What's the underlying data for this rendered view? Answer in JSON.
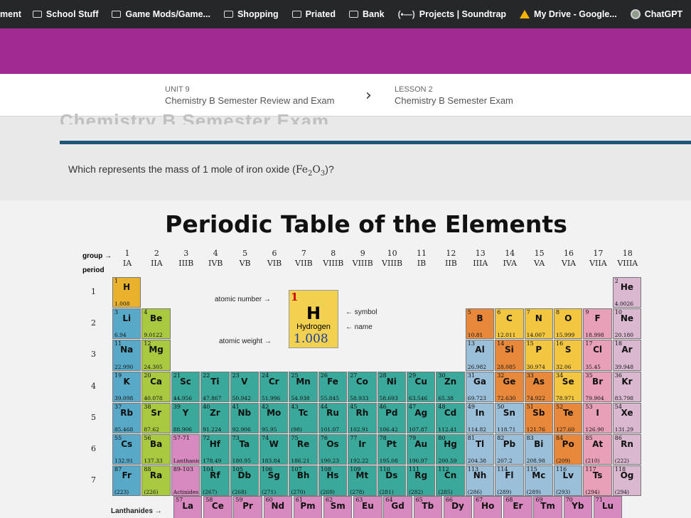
{
  "bookmarks": [
    {
      "label": "ment",
      "icon": "none"
    },
    {
      "label": "School Stuff",
      "icon": "folder-icon"
    },
    {
      "label": "Game Mods/Game...",
      "icon": "folder-icon"
    },
    {
      "label": "Shopping",
      "icon": "folder-icon"
    },
    {
      "label": "Priated",
      "icon": "folder-icon"
    },
    {
      "label": "Bank",
      "icon": "folder-icon"
    },
    {
      "label": "Projects | Soundtrap",
      "icon": "soundtrap-icon"
    },
    {
      "label": "My Drive - Google...",
      "icon": "google-drive-icon"
    },
    {
      "label": "ChatGPT",
      "icon": "chatgpt-icon"
    }
  ],
  "colors": {
    "band": "#a02a92",
    "rule": "#1d5676",
    "bookmark_bar": "#26272b"
  },
  "breadcrumb": {
    "unit_label": "UNIT 9",
    "unit_title": "Chemistry B Semester Review and Exam",
    "lesson_label": "LESSON 2",
    "lesson_title": "Chemistry B Semester Exam",
    "separator": "›"
  },
  "page_title": "Chemistry B Semester Exam",
  "question": {
    "text": "Which represents the mass of 1 mole of iron oxide (",
    "formula": "Fe",
    "sub1": "2",
    "o": "O",
    "sub2": "3",
    "end": ")?"
  },
  "table": {
    "title": "Periodic Table of the Elements",
    "group_label": "group",
    "period_label": "period",
    "groups": [
      "1",
      "2",
      "3",
      "4",
      "5",
      "6",
      "7",
      "8",
      "9",
      "10",
      "11",
      "12",
      "13",
      "14",
      "15",
      "16",
      "17",
      "18"
    ],
    "group_roman": [
      "IA",
      "IIA",
      "IIIB",
      "IVB",
      "VB",
      "VIB",
      "VIIB",
      "VIIIB",
      "VIIIB",
      "VIIIB",
      "IB",
      "IIB",
      "IIIA",
      "IVA",
      "VA",
      "VIA",
      "VIIA",
      "VIIIA"
    ],
    "periods": [
      "1",
      "2",
      "3",
      "4",
      "5",
      "6",
      "7"
    ],
    "key": {
      "atomic_number_label": "atomic number",
      "atomic_number": "1",
      "symbol_label": "symbol",
      "symbol": "H",
      "name_label": "name",
      "name": "Hydrogen",
      "atomic_weight_label": "atomic weight",
      "atomic_weight": "1.008"
    },
    "lanthanides_label": "Lanthanides",
    "elements": [
      {
        "z": "1",
        "s": "H",
        "m": "1.008",
        "c": "#e8b22e",
        "col": 1,
        "row": 1
      },
      {
        "z": "2",
        "s": "He",
        "m": "4.0026",
        "c": "#d9b8d0",
        "col": 18,
        "row": 1
      },
      {
        "z": "3",
        "s": "Li",
        "m": "6.94",
        "c": "#58a8c8",
        "col": 1,
        "row": 2
      },
      {
        "z": "4",
        "s": "Be",
        "m": "9.0122",
        "c": "#a8c940",
        "col": 2,
        "row": 2
      },
      {
        "z": "5",
        "s": "B",
        "m": "10.81",
        "c": "#e8883a",
        "col": 13,
        "row": 2
      },
      {
        "z": "6",
        "s": "C",
        "m": "12.011",
        "c": "#f2c640",
        "col": 14,
        "row": 2
      },
      {
        "z": "7",
        "s": "N",
        "m": "14.007",
        "c": "#f2c640",
        "col": 15,
        "row": 2
      },
      {
        "z": "8",
        "s": "O",
        "m": "15.999",
        "c": "#f2c640",
        "col": 16,
        "row": 2
      },
      {
        "z": "9",
        "s": "F",
        "m": "18.998",
        "c": "#e8a0b8",
        "col": 17,
        "row": 2
      },
      {
        "z": "10",
        "s": "Ne",
        "m": "20.180",
        "c": "#d9b8d0",
        "col": 18,
        "row": 2
      },
      {
        "z": "11",
        "s": "Na",
        "m": "22.990",
        "c": "#58a8c8",
        "col": 1,
        "row": 3
      },
      {
        "z": "12",
        "s": "Mg",
        "m": "24.305",
        "c": "#a8c940",
        "col": 2,
        "row": 3
      },
      {
        "z": "13",
        "s": "Al",
        "m": "26.982",
        "c": "#9bbfd8",
        "col": 13,
        "row": 3
      },
      {
        "z": "14",
        "s": "Si",
        "m": "28.085",
        "c": "#e8883a",
        "col": 14,
        "row": 3
      },
      {
        "z": "15",
        "s": "P",
        "m": "30.974",
        "c": "#f2c640",
        "col": 15,
        "row": 3
      },
      {
        "z": "16",
        "s": "S",
        "m": "32.06",
        "c": "#f2c640",
        "col": 16,
        "row": 3
      },
      {
        "z": "17",
        "s": "Cl",
        "m": "35.45",
        "c": "#e8a0b8",
        "col": 17,
        "row": 3
      },
      {
        "z": "18",
        "s": "Ar",
        "m": "39.948",
        "c": "#d9b8d0",
        "col": 18,
        "row": 3
      },
      {
        "z": "19",
        "s": "K",
        "m": "39.098",
        "c": "#58a8c8",
        "col": 1,
        "row": 4
      },
      {
        "z": "20",
        "s": "Ca",
        "m": "40.078",
        "c": "#a8c940",
        "col": 2,
        "row": 4
      },
      {
        "z": "21",
        "s": "Sc",
        "m": "44.956",
        "c": "#3aa89a",
        "col": 3,
        "row": 4
      },
      {
        "z": "22",
        "s": "Ti",
        "m": "47.867",
        "c": "#3aa89a",
        "col": 4,
        "row": 4
      },
      {
        "z": "23",
        "s": "V",
        "m": "50.942",
        "c": "#3aa89a",
        "col": 5,
        "row": 4
      },
      {
        "z": "24",
        "s": "Cr",
        "m": "51.996",
        "c": "#3aa89a",
        "col": 6,
        "row": 4
      },
      {
        "z": "25",
        "s": "Mn",
        "m": "54.938",
        "c": "#3aa89a",
        "col": 7,
        "row": 4
      },
      {
        "z": "26",
        "s": "Fe",
        "m": "55.845",
        "c": "#3aa89a",
        "col": 8,
        "row": 4
      },
      {
        "z": "27",
        "s": "Co",
        "m": "58.933",
        "c": "#3aa89a",
        "col": 9,
        "row": 4
      },
      {
        "z": "28",
        "s": "Ni",
        "m": "58.693",
        "c": "#3aa89a",
        "col": 10,
        "row": 4
      },
      {
        "z": "29",
        "s": "Cu",
        "m": "63.546",
        "c": "#3aa89a",
        "col": 11,
        "row": 4
      },
      {
        "z": "30",
        "s": "Zn",
        "m": "65.38",
        "c": "#3aa89a",
        "col": 12,
        "row": 4
      },
      {
        "z": "31",
        "s": "Ga",
        "m": "69.723",
        "c": "#9bbfd8",
        "col": 13,
        "row": 4
      },
      {
        "z": "32",
        "s": "Ge",
        "m": "72.630",
        "c": "#e8883a",
        "col": 14,
        "row": 4
      },
      {
        "z": "33",
        "s": "As",
        "m": "74.922",
        "c": "#e8883a",
        "col": 15,
        "row": 4
      },
      {
        "z": "34",
        "s": "Se",
        "m": "78.971",
        "c": "#f2c640",
        "col": 16,
        "row": 4
      },
      {
        "z": "35",
        "s": "Br",
        "m": "79.904",
        "c": "#e8a0b8",
        "col": 17,
        "row": 4
      },
      {
        "z": "36",
        "s": "Kr",
        "m": "83.798",
        "c": "#d9b8d0",
        "col": 18,
        "row": 4
      },
      {
        "z": "37",
        "s": "Rb",
        "m": "85.468",
        "c": "#58a8c8",
        "col": 1,
        "row": 5
      },
      {
        "z": "38",
        "s": "Sr",
        "m": "87.62",
        "c": "#a8c940",
        "col": 2,
        "row": 5
      },
      {
        "z": "39",
        "s": "Y",
        "m": "88.906",
        "c": "#3aa89a",
        "col": 3,
        "row": 5
      },
      {
        "z": "40",
        "s": "Zr",
        "m": "91.224",
        "c": "#3aa89a",
        "col": 4,
        "row": 5
      },
      {
        "z": "41",
        "s": "Nb",
        "m": "92.906",
        "c": "#3aa89a",
        "col": 5,
        "row": 5
      },
      {
        "z": "42",
        "s": "Mo",
        "m": "95.95",
        "c": "#3aa89a",
        "col": 6,
        "row": 5
      },
      {
        "z": "43",
        "s": "Tc",
        "m": "(98)",
        "c": "#3aa89a",
        "col": 7,
        "row": 5
      },
      {
        "z": "44",
        "s": "Ru",
        "m": "101.07",
        "c": "#3aa89a",
        "col": 8,
        "row": 5
      },
      {
        "z": "45",
        "s": "Rh",
        "m": "102.91",
        "c": "#3aa89a",
        "col": 9,
        "row": 5
      },
      {
        "z": "46",
        "s": "Pd",
        "m": "106.42",
        "c": "#3aa89a",
        "col": 10,
        "row": 5
      },
      {
        "z": "47",
        "s": "Ag",
        "m": "107.87",
        "c": "#3aa89a",
        "col": 11,
        "row": 5
      },
      {
        "z": "48",
        "s": "Cd",
        "m": "112.41",
        "c": "#3aa89a",
        "col": 12,
        "row": 5
      },
      {
        "z": "49",
        "s": "In",
        "m": "114.82",
        "c": "#9bbfd8",
        "col": 13,
        "row": 5
      },
      {
        "z": "50",
        "s": "Sn",
        "m": "118.71",
        "c": "#9bbfd8",
        "col": 14,
        "row": 5
      },
      {
        "z": "51",
        "s": "Sb",
        "m": "121.76",
        "c": "#e8883a",
        "col": 15,
        "row": 5
      },
      {
        "z": "52",
        "s": "Te",
        "m": "127.60",
        "c": "#e8883a",
        "col": 16,
        "row": 5
      },
      {
        "z": "53",
        "s": "I",
        "m": "126.90",
        "c": "#e8a0b8",
        "col": 17,
        "row": 5
      },
      {
        "z": "54",
        "s": "Xe",
        "m": "131.29",
        "c": "#d9b8d0",
        "col": 18,
        "row": 5
      },
      {
        "z": "55",
        "s": "Cs",
        "m": "132.91",
        "c": "#58a8c8",
        "col": 1,
        "row": 6
      },
      {
        "z": "56",
        "s": "Ba",
        "m": "137.33",
        "c": "#a8c940",
        "col": 2,
        "row": 6
      },
      {
        "z": "57-71",
        "s": "",
        "m": "Lanthanides",
        "c": "#d88ac0",
        "col": 3,
        "row": 6
      },
      {
        "z": "72",
        "s": "Hf",
        "m": "178.49",
        "c": "#3aa89a",
        "col": 4,
        "row": 6
      },
      {
        "z": "73",
        "s": "Ta",
        "m": "180.95",
        "c": "#3aa89a",
        "col": 5,
        "row": 6
      },
      {
        "z": "74",
        "s": "W",
        "m": "183.84",
        "c": "#3aa89a",
        "col": 6,
        "row": 6
      },
      {
        "z": "75",
        "s": "Re",
        "m": "186.21",
        "c": "#3aa89a",
        "col": 7,
        "row": 6
      },
      {
        "z": "76",
        "s": "Os",
        "m": "190.23",
        "c": "#3aa89a",
        "col": 8,
        "row": 6
      },
      {
        "z": "77",
        "s": "Ir",
        "m": "192.22",
        "c": "#3aa89a",
        "col": 9,
        "row": 6
      },
      {
        "z": "78",
        "s": "Pt",
        "m": "195.08",
        "c": "#3aa89a",
        "col": 10,
        "row": 6
      },
      {
        "z": "79",
        "s": "Au",
        "m": "196.97",
        "c": "#3aa89a",
        "col": 11,
        "row": 6
      },
      {
        "z": "80",
        "s": "Hg",
        "m": "200.59",
        "c": "#3aa89a",
        "col": 12,
        "row": 6
      },
      {
        "z": "81",
        "s": "Tl",
        "m": "204.38",
        "c": "#9bbfd8",
        "col": 13,
        "row": 6
      },
      {
        "z": "82",
        "s": "Pb",
        "m": "207.2",
        "c": "#9bbfd8",
        "col": 14,
        "row": 6
      },
      {
        "z": "83",
        "s": "Bi",
        "m": "208.98",
        "c": "#9bbfd8",
        "col": 15,
        "row": 6
      },
      {
        "z": "84",
        "s": "Po",
        "m": "(209)",
        "c": "#e8883a",
        "col": 16,
        "row": 6
      },
      {
        "z": "85",
        "s": "At",
        "m": "(210)",
        "c": "#e8a0b8",
        "col": 17,
        "row": 6
      },
      {
        "z": "86",
        "s": "Rn",
        "m": "(222)",
        "c": "#d9b8d0",
        "col": 18,
        "row": 6
      },
      {
        "z": "87",
        "s": "Fr",
        "m": "(223)",
        "c": "#58a8c8",
        "col": 1,
        "row": 7
      },
      {
        "z": "88",
        "s": "Ra",
        "m": "(226)",
        "c": "#a8c940",
        "col": 2,
        "row": 7
      },
      {
        "z": "89-103",
        "s": "",
        "m": "Actinides",
        "c": "#d88ac0",
        "col": 3,
        "row": 7
      },
      {
        "z": "104",
        "s": "Rf",
        "m": "(267)",
        "c": "#3aa89a",
        "col": 4,
        "row": 7
      },
      {
        "z": "105",
        "s": "Db",
        "m": "(268)",
        "c": "#3aa89a",
        "col": 5,
        "row": 7
      },
      {
        "z": "106",
        "s": "Sg",
        "m": "(271)",
        "c": "#3aa89a",
        "col": 6,
        "row": 7
      },
      {
        "z": "107",
        "s": "Bh",
        "m": "(270)",
        "c": "#3aa89a",
        "col": 7,
        "row": 7
      },
      {
        "z": "108",
        "s": "Hs",
        "m": "(269)",
        "c": "#3aa89a",
        "col": 8,
        "row": 7
      },
      {
        "z": "109",
        "s": "Mt",
        "m": "(278)",
        "c": "#3aa89a",
        "col": 9,
        "row": 7
      },
      {
        "z": "110",
        "s": "Ds",
        "m": "(281)",
        "c": "#3aa89a",
        "col": 10,
        "row": 7
      },
      {
        "z": "111",
        "s": "Rg",
        "m": "(282)",
        "c": "#3aa89a",
        "col": 11,
        "row": 7
      },
      {
        "z": "112",
        "s": "Cn",
        "m": "(285)",
        "c": "#3aa89a",
        "col": 12,
        "row": 7
      },
      {
        "z": "113",
        "s": "Nh",
        "m": "(286)",
        "c": "#9bbfd8",
        "col": 13,
        "row": 7
      },
      {
        "z": "114",
        "s": "Fl",
        "m": "(289)",
        "c": "#9bbfd8",
        "col": 14,
        "row": 7
      },
      {
        "z": "115",
        "s": "Mc",
        "m": "(289)",
        "c": "#9bbfd8",
        "col": 15,
        "row": 7
      },
      {
        "z": "116",
        "s": "Lv",
        "m": "(293)",
        "c": "#9bbfd8",
        "col": 16,
        "row": 7
      },
      {
        "z": "117",
        "s": "Ts",
        "m": "(294)",
        "c": "#e8a0b8",
        "col": 17,
        "row": 7
      },
      {
        "z": "118",
        "s": "Og",
        "m": "(294)",
        "c": "#d9b8d0",
        "col": 18,
        "row": 7
      }
    ],
    "lanthanides": [
      {
        "z": "57",
        "s": "La"
      },
      {
        "z": "58",
        "s": "Ce"
      },
      {
        "z": "59",
        "s": "Pr"
      },
      {
        "z": "60",
        "s": "Nd"
      },
      {
        "z": "61",
        "s": "Pm"
      },
      {
        "z": "62",
        "s": "Sm"
      },
      {
        "z": "63",
        "s": "Eu"
      },
      {
        "z": "64",
        "s": "Gd"
      },
      {
        "z": "65",
        "s": "Tb"
      },
      {
        "z": "66",
        "s": "Dy"
      },
      {
        "z": "67",
        "s": "Ho"
      },
      {
        "z": "68",
        "s": "Er"
      },
      {
        "z": "69",
        "s": "Tm"
      },
      {
        "z": "70",
        "s": "Yb"
      },
      {
        "z": "71",
        "s": "Lu"
      }
    ],
    "lanthanide_color": "#d88ac0"
  }
}
